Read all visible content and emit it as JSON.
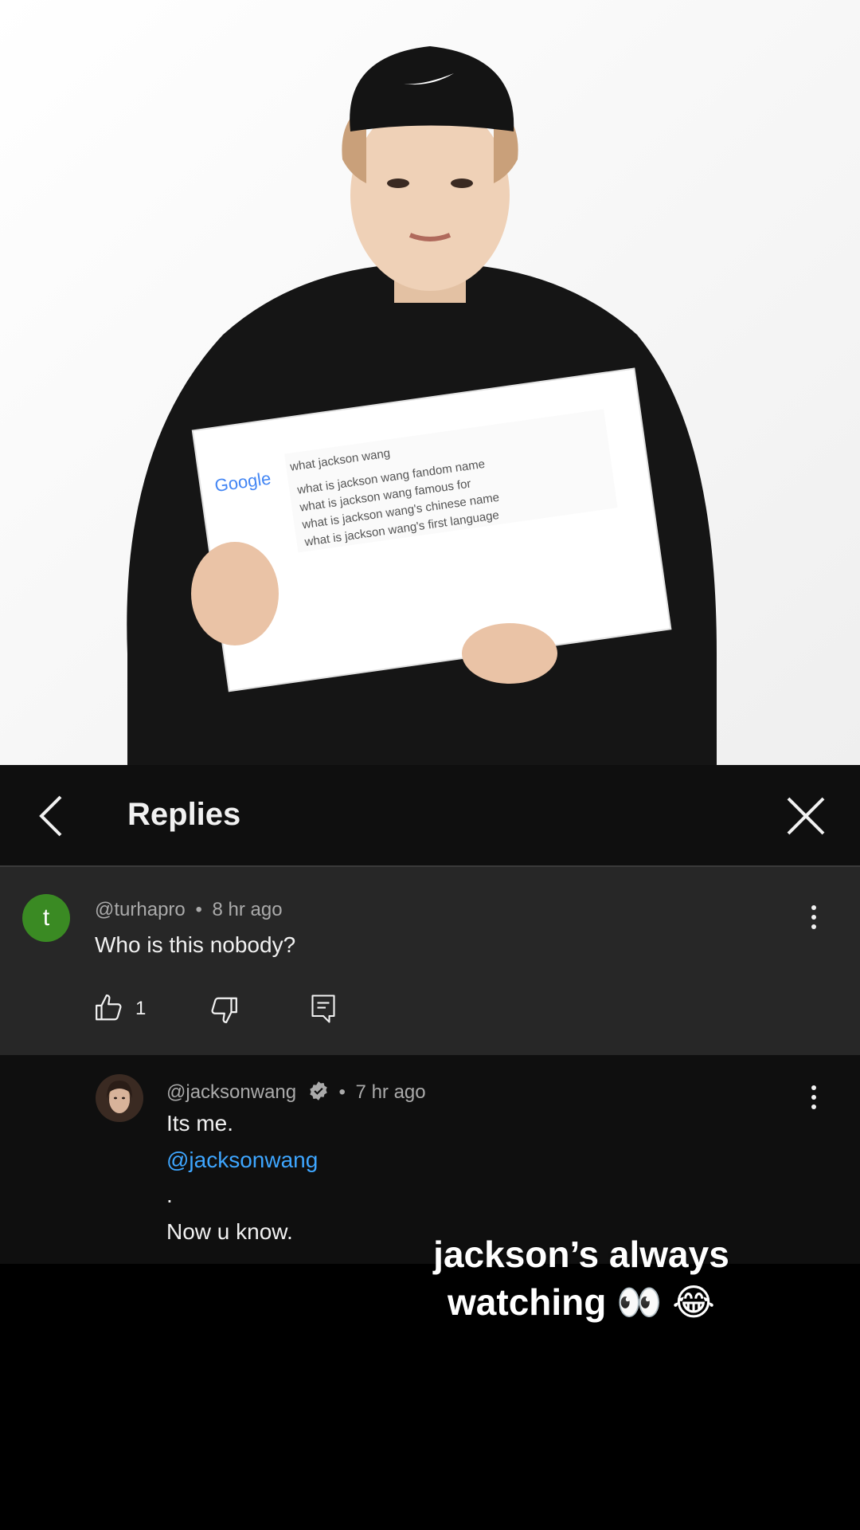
{
  "video": {
    "sign": {
      "logo": "Google",
      "query": "what jackson wang",
      "suggestions": [
        "what is jackson wang fandom name",
        "what is jackson wang famous for",
        "what is jackson wang's chinese name",
        "what is jackson wang's first language"
      ]
    }
  },
  "replies_panel": {
    "title": "Replies",
    "parent": {
      "avatar_letter": "t",
      "author": "@turhapro",
      "separator": "•",
      "time": "8 hr ago",
      "text": "Who is this nobody?",
      "likes": "1"
    },
    "reply": {
      "author": "@jacksonwang",
      "separator": "•",
      "time": "7 hr ago",
      "line1": "Its me.",
      "mention": "@jacksonwang",
      "line2": ".",
      "line3": "Now u know."
    }
  },
  "caption": {
    "line1": "jackson’s always",
    "line2": "watching 👀 😂"
  },
  "colors": {
    "header_bg": "#0f0f0f",
    "parent_bg": "#272727",
    "avatar_green": "#3a8a23",
    "mention_blue": "#3ea6ff"
  }
}
